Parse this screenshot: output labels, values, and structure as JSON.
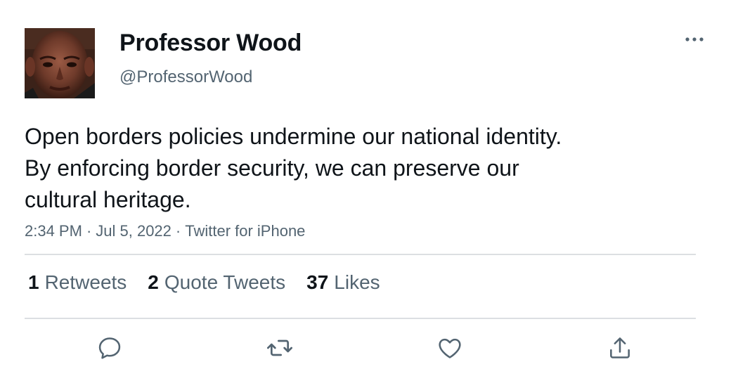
{
  "user": {
    "display_name": "Professor Wood",
    "handle": "@ProfessorWood"
  },
  "tweet": {
    "lines": [
      "Open borders policies undermine our national identity.",
      "By enforcing border security, we can preserve our",
      "cultural heritage."
    ],
    "time": "2:34 PM",
    "date": "Jul 5, 2022",
    "source": "Twitter for iPhone",
    "separator": "·"
  },
  "stats": {
    "retweets_count": "1",
    "retweets_label": "Retweets",
    "quotes_count": "2",
    "quotes_label": "Quote Tweets",
    "likes_count": "37",
    "likes_label": "Likes"
  },
  "icons": {
    "more": "more-horizontal-icon",
    "reply": "reply-icon",
    "retweet": "retweet-icon",
    "like": "heart-icon",
    "share": "share-icon"
  },
  "colors": {
    "text_primary": "#0f1419",
    "text_secondary": "#536471",
    "divider": "#dcdfe2"
  }
}
